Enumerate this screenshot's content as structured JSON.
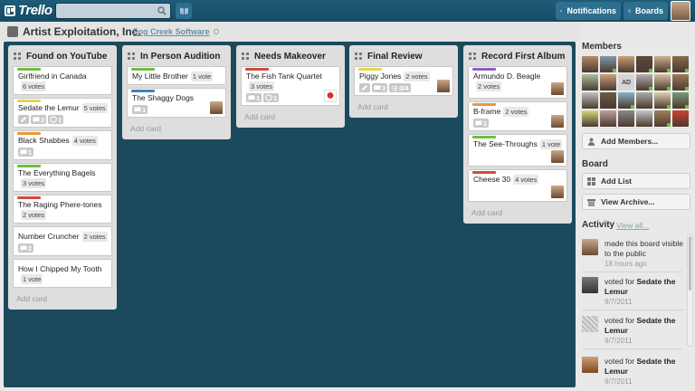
{
  "header": {
    "logo": "Trello",
    "search": {
      "value": "",
      "placeholder": ""
    },
    "notifications_label": "Notifications",
    "boards_label": "Boards"
  },
  "board": {
    "title": "Artist Exploitation, Inc.",
    "organization": "Fog Creek Software"
  },
  "colors": {
    "label_green": "#6cbf3e",
    "label_yellow": "#e3d74a",
    "label_orange": "#e79a36",
    "label_red": "#cf4b40",
    "label_purple": "#8e5fbf",
    "label_blue": "#3f80c4"
  },
  "lists": [
    {
      "title": "Found on YouTube",
      "add_card": "Add card",
      "cards": [
        {
          "title": "Girlfriend in Canada",
          "votes": "6 votes",
          "label": "label_green"
        },
        {
          "title": "Sedate the Lemur",
          "votes": "5 votes",
          "label": "label_yellow",
          "badges": {
            "comments": "2",
            "checklist": "1"
          }
        },
        {
          "title": "Black Shabbes",
          "votes": "4 votes",
          "label": "label_orange",
          "badges": {
            "comments": "1"
          }
        },
        {
          "title": "The Everything Bagels",
          "votes": "3 votes",
          "label": "label_green"
        },
        {
          "title": "The Raging Phere-tones",
          "votes": "2 votes",
          "label": "label_red"
        },
        {
          "title": "Number Cruncher",
          "votes": "2 votes",
          "badges": {
            "comments": "2"
          }
        },
        {
          "title": "How I Chipped My Tooth",
          "votes": "1 vote"
        }
      ]
    },
    {
      "title": "In Person Audition",
      "add_card": "Add card",
      "cards": [
        {
          "title": "My Little Brother",
          "votes": "1 vote",
          "label": "label_green"
        },
        {
          "title": "The Shaggy Dogs",
          "votes": "",
          "label": "label_blue",
          "badges": {
            "comments": "1"
          }
        }
      ]
    },
    {
      "title": "Needs Makeover",
      "add_card": "Add card",
      "cards": [
        {
          "title": "The Fish Tank Quartet",
          "votes": "3 votes",
          "label": "label_red",
          "badges": {
            "comments": "1",
            "checklist": "1"
          }
        }
      ]
    },
    {
      "title": "Final Review",
      "add_card": "Add card",
      "cards": [
        {
          "title": "Piggy Jones",
          "votes": "2 votes",
          "label": "label_yellow",
          "badges": {
            "comments": "3",
            "checklist": "0/4"
          }
        }
      ]
    },
    {
      "title": "Record First Album",
      "add_card": "Add card",
      "cards": [
        {
          "title": "Armundo D. Beagle",
          "votes": "2 votes",
          "label": "label_purple"
        },
        {
          "title": "B-frame",
          "votes": "2 votes",
          "label": "label_orange",
          "badges": {
            "comments": "1"
          }
        },
        {
          "title": "The See-Throughs",
          "votes": "1 vote",
          "label": "label_green"
        },
        {
          "title": "Cheese 30",
          "votes": "4 votes",
          "label": "label_red"
        }
      ]
    }
  ],
  "sidebar": {
    "members_title": "Members",
    "member_initials": "AD",
    "add_members": "Add Members...",
    "board_title": "Board",
    "add_list": "Add List",
    "view_archive": "View Archive...",
    "activity_title": "Activity",
    "view_all": "View all...",
    "activity": [
      {
        "text": "made this board visible to the public",
        "date": "18 hours ago"
      },
      {
        "text": "voted for ",
        "target": "Sedate the Lemur",
        "date": "9/7/2011"
      },
      {
        "text": "voted for ",
        "target": "Sedate the Lemur",
        "date": "9/7/2011"
      },
      {
        "text": "voted for ",
        "target": "Sedate the Lemur",
        "date": "9/7/2011"
      }
    ]
  }
}
